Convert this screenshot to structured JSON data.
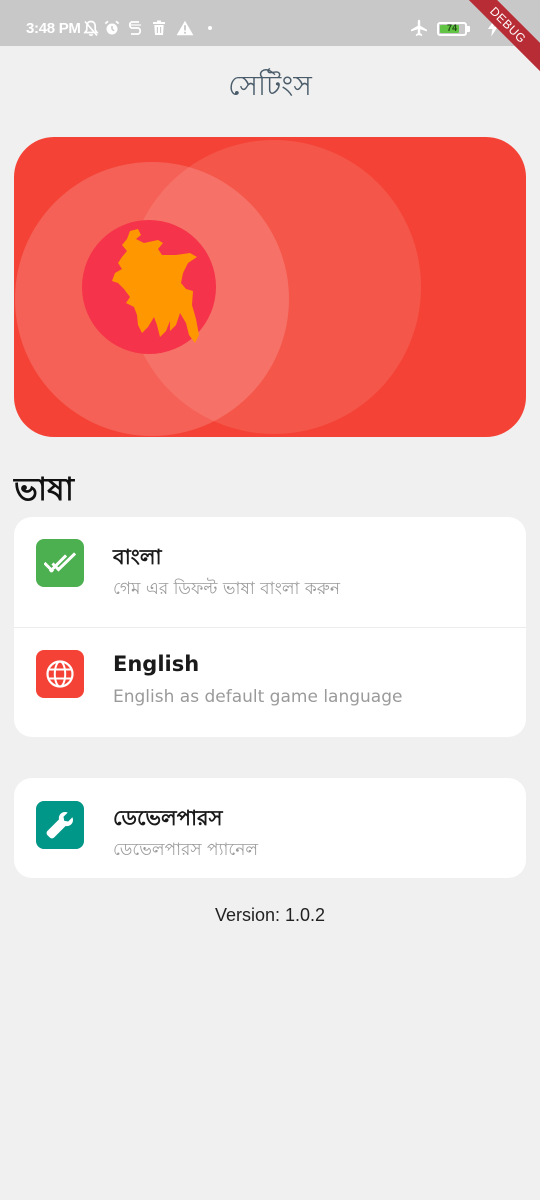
{
  "status_bar": {
    "time": "3:48 PM",
    "battery_level": "74",
    "debug_banner": "DEBUG",
    "icons": [
      "notifications-off-icon",
      "alarm-icon",
      "sim-icon",
      "trash-icon",
      "warning-icon",
      "dot-icon",
      "airplane-mode-icon",
      "battery-icon",
      "charging-icon"
    ]
  },
  "header": {
    "title": "সেটিংস"
  },
  "banner": {
    "background_color": "#f44336",
    "flag_red": "#f5334a",
    "map_color": "#ff9800",
    "icon": "bangladesh-map-icon"
  },
  "language_section": {
    "title": "ভাষা",
    "items": [
      {
        "title": "বাংলা",
        "subtitle": "গেম এর ডিফল্ট ভাষা বাংলা করুন",
        "icon": "double-check-icon",
        "icon_color": "#4caf50"
      },
      {
        "title": "English",
        "subtitle": "English as default game language",
        "icon": "globe-icon",
        "icon_color": "#f44336"
      }
    ]
  },
  "developer_section": {
    "items": [
      {
        "title": "ডেভেলপারস",
        "subtitle": "ডেভেলপারস প্যানেল",
        "icon": "wrench-icon",
        "icon_color": "#009688"
      }
    ]
  },
  "footer": {
    "version": "Version: 1.0.2"
  }
}
